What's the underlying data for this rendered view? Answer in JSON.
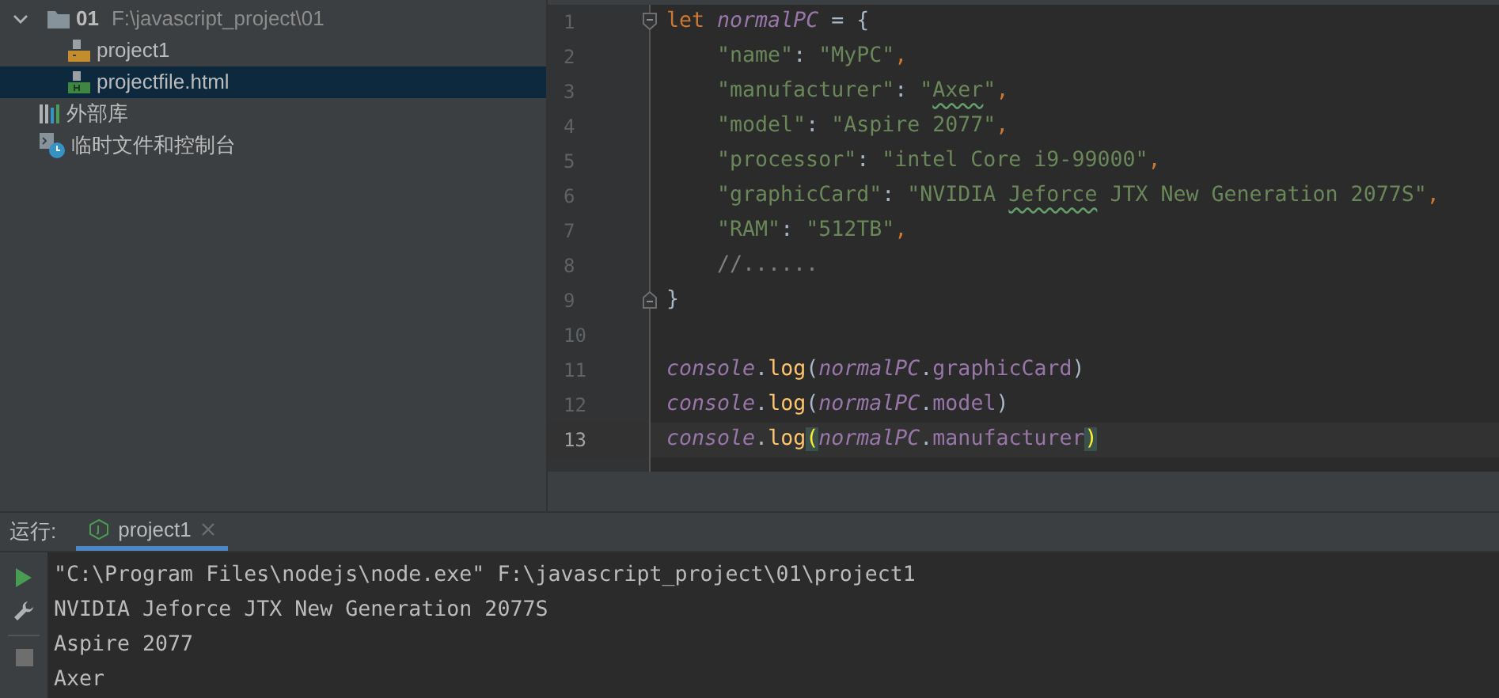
{
  "project_tree": [
    {
      "name": "01",
      "path": "F:\\javascript_project\\01",
      "kind": "folder",
      "expanded": true,
      "selected": false,
      "children": [
        {
          "name": "project1",
          "kind": "js",
          "selected": false
        },
        {
          "name": "projectfile.html",
          "kind": "html",
          "selected": true
        }
      ]
    },
    {
      "name": "外部库",
      "kind": "library",
      "selected": false
    },
    {
      "name": "临时文件和控制台",
      "kind": "scratch",
      "selected": false
    }
  ],
  "editor": {
    "lines": [
      {
        "number": "1",
        "fold_start": true,
        "current": false,
        "tokens": [
          {
            "text": "let",
            "kind": "keyword"
          },
          {
            "text": " normalPC",
            "kind": "variable"
          },
          {
            "text": " = {",
            "kind": "punct"
          }
        ]
      },
      {
        "number": "2",
        "current": false,
        "tokens": [
          {
            "text": "    \"name\"",
            "kind": "string"
          },
          {
            "text": ": ",
            "kind": "punct"
          },
          {
            "text": "\"MyPC\"",
            "kind": "string"
          },
          {
            "text": ",",
            "kind": "keyword"
          }
        ]
      },
      {
        "number": "3",
        "current": false,
        "tokens": [
          {
            "text": "    \"manufacturer\"",
            "kind": "string"
          },
          {
            "text": ": ",
            "kind": "punct"
          },
          {
            "text": "\"",
            "kind": "string"
          },
          {
            "text": "Axer",
            "kind": "string",
            "typo": true
          },
          {
            "text": "\"",
            "kind": "string"
          },
          {
            "text": ",",
            "kind": "keyword"
          }
        ]
      },
      {
        "number": "4",
        "current": false,
        "tokens": [
          {
            "text": "    \"model\"",
            "kind": "string"
          },
          {
            "text": ": ",
            "kind": "punct"
          },
          {
            "text": "\"Aspire 2077\"",
            "kind": "string"
          },
          {
            "text": ",",
            "kind": "keyword"
          }
        ]
      },
      {
        "number": "5",
        "current": false,
        "tokens": [
          {
            "text": "    \"processor\"",
            "kind": "string"
          },
          {
            "text": ": ",
            "kind": "punct"
          },
          {
            "text": "\"intel Core i9-99000\"",
            "kind": "string"
          },
          {
            "text": ",",
            "kind": "keyword"
          }
        ]
      },
      {
        "number": "6",
        "current": false,
        "tokens": [
          {
            "text": "    \"graphicCard\"",
            "kind": "string"
          },
          {
            "text": ": ",
            "kind": "punct"
          },
          {
            "text": "\"NVIDIA ",
            "kind": "string"
          },
          {
            "text": "Jeforce",
            "kind": "string",
            "typo": true
          },
          {
            "text": " JTX New Generation 2077S\"",
            "kind": "string"
          },
          {
            "text": ",",
            "kind": "keyword"
          }
        ]
      },
      {
        "number": "7",
        "current": false,
        "tokens": [
          {
            "text": "    \"RAM\"",
            "kind": "string"
          },
          {
            "text": ": ",
            "kind": "punct"
          },
          {
            "text": "\"512TB\"",
            "kind": "string"
          },
          {
            "text": ",",
            "kind": "keyword"
          }
        ]
      },
      {
        "number": "8",
        "current": false,
        "tokens": [
          {
            "text": "    //......",
            "kind": "comment"
          }
        ]
      },
      {
        "number": "9",
        "fold_end": true,
        "current": false,
        "tokens": [
          {
            "text": "}",
            "kind": "punct"
          }
        ]
      },
      {
        "number": "10",
        "current": false
      },
      {
        "number": "11",
        "current": false,
        "tokens": [
          {
            "text": "console",
            "kind": "variable"
          },
          {
            "text": ".",
            "kind": "punct"
          },
          {
            "text": "log",
            "kind": "method"
          },
          {
            "text": "(",
            "kind": "punct"
          },
          {
            "text": "normalPC",
            "kind": "variable"
          },
          {
            "text": ".",
            "kind": "punct"
          },
          {
            "text": "graphicCard",
            "kind": "field"
          },
          {
            "text": ")",
            "kind": "punct"
          }
        ]
      },
      {
        "number": "12",
        "current": false,
        "tokens": [
          {
            "text": "console",
            "kind": "variable"
          },
          {
            "text": ".",
            "kind": "punct"
          },
          {
            "text": "log",
            "kind": "method"
          },
          {
            "text": "(",
            "kind": "punct"
          },
          {
            "text": "normalPC",
            "kind": "variable"
          },
          {
            "text": ".",
            "kind": "punct"
          },
          {
            "text": "model",
            "kind": "field"
          },
          {
            "text": ")",
            "kind": "punct"
          }
        ]
      },
      {
        "number": "13",
        "current": true,
        "tokens": [
          {
            "text": "console",
            "kind": "variable"
          },
          {
            "text": ".",
            "kind": "punct"
          },
          {
            "text": "log",
            "kind": "method"
          },
          {
            "text": "(",
            "kind": "punct",
            "matched": true
          },
          {
            "text": "normalPC",
            "kind": "variable"
          },
          {
            "text": ".",
            "kind": "punct"
          },
          {
            "text": "manufacturer",
            "kind": "field"
          },
          {
            "text": ")",
            "kind": "punct",
            "matched": true
          }
        ]
      }
    ]
  },
  "run_panel": {
    "label": "运行:",
    "tabs": [
      {
        "label": "project1",
        "selected": true
      }
    ],
    "output": [
      "\"C:\\Program Files\\nodejs\\node.exe\" F:\\javascript_project\\01\\project1",
      "NVIDIA Jeforce JTX New Generation 2077S",
      "Aspire 2077",
      "Axer"
    ]
  }
}
